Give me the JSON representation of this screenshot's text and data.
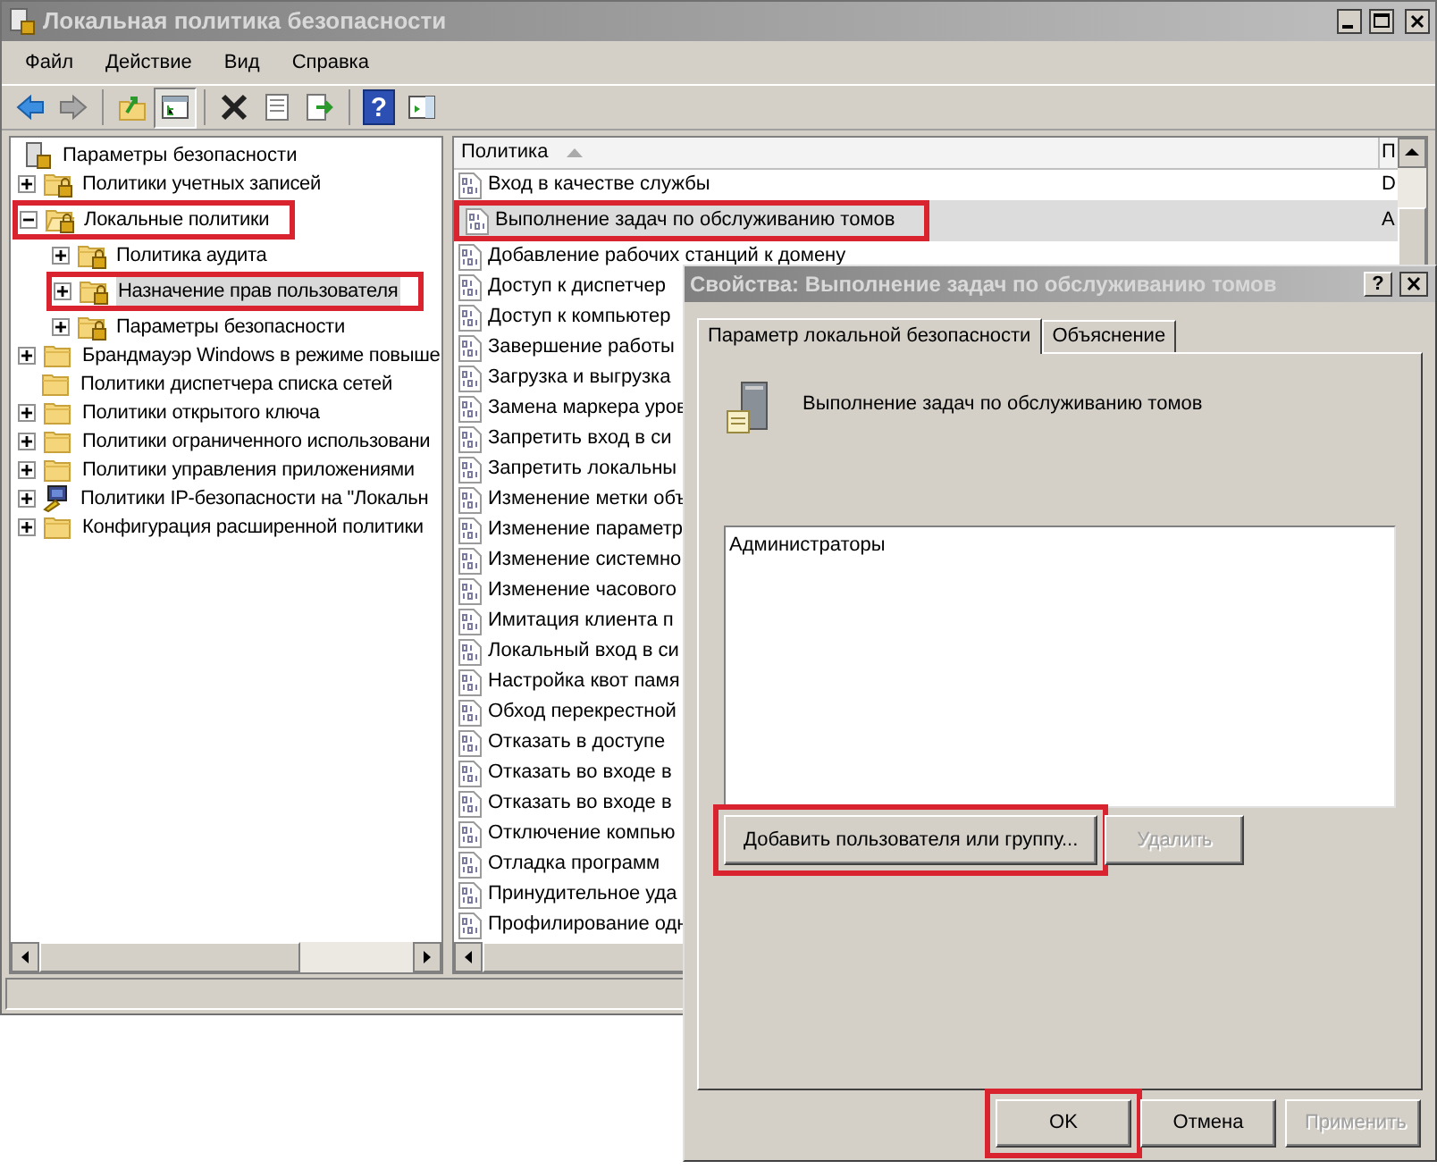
{
  "window": {
    "title": "Локальная политика безопасности"
  },
  "menu": [
    "Файл",
    "Действие",
    "Вид",
    "Справка"
  ],
  "toolbar": [
    [
      {
        "kind": "back",
        "pressed": false
      },
      {
        "kind": "forward",
        "pressed": false
      }
    ],
    [
      {
        "kind": "up",
        "pressed": false
      },
      {
        "kind": "tree",
        "pressed": true
      }
    ],
    [
      {
        "kind": "delete",
        "pressed": false
      },
      {
        "kind": "properties",
        "pressed": false
      },
      {
        "kind": "export",
        "pressed": false
      }
    ],
    [
      {
        "kind": "help",
        "pressed": false,
        "label": "?"
      },
      {
        "kind": "action-pane",
        "pressed": false
      }
    ]
  ],
  "tree": {
    "root": "Параметры безопасности",
    "items": [
      {
        "label": "Политики учетных записей",
        "kind": "secure-folder",
        "has_children": true,
        "expanded": false,
        "selected": false,
        "highlighted": false
      },
      {
        "label": "Локальные политики",
        "kind": "secure-folder",
        "has_children": true,
        "expanded": true,
        "selected": false,
        "highlighted": true,
        "children": [
          {
            "label": "Политика аудита",
            "kind": "secure-folder",
            "has_children": true,
            "expanded": false,
            "selected": false,
            "highlighted": false
          },
          {
            "label": "Назначение прав пользователя",
            "kind": "secure-folder",
            "has_children": true,
            "expanded": false,
            "selected": true,
            "highlighted": true
          },
          {
            "label": "Параметры безопасности",
            "kind": "secure-folder",
            "has_children": true,
            "expanded": false,
            "selected": false,
            "highlighted": false
          }
        ]
      },
      {
        "label": "Брандмауэр Windows в режиме повыше",
        "kind": "folder",
        "has_children": true,
        "expanded": false,
        "selected": false,
        "highlighted": false
      },
      {
        "label": "Политики диспетчера списка сетей",
        "kind": "folder",
        "has_children": false,
        "expanded": false,
        "selected": false,
        "highlighted": false
      },
      {
        "label": "Политики открытого ключа",
        "kind": "folder",
        "has_children": true,
        "expanded": false,
        "selected": false,
        "highlighted": false
      },
      {
        "label": "Политики ограниченного использовани",
        "kind": "folder",
        "has_children": true,
        "expanded": false,
        "selected": false,
        "highlighted": false
      },
      {
        "label": "Политики управления приложениями",
        "kind": "folder",
        "has_children": true,
        "expanded": false,
        "selected": false,
        "highlighted": false
      },
      {
        "label": "Политики IP-безопасности на \"Локальн",
        "kind": "ip-security",
        "has_children": true,
        "expanded": false,
        "selected": false,
        "highlighted": false
      },
      {
        "label": "Конфигурация расширенной политики",
        "kind": "folder",
        "has_children": true,
        "expanded": false,
        "selected": false,
        "highlighted": false
      }
    ]
  },
  "list": {
    "columns": [
      "Политика",
      "П"
    ],
    "rows": [
      {
        "cells": [
          "Вход в качестве службы",
          "D"
        ],
        "selected": false,
        "highlighted": false
      },
      {
        "cells": [
          "Выполнение задач по обслуживанию томов",
          "A"
        ],
        "selected": true,
        "highlighted": true
      },
      {
        "cells": [
          "Добавление рабочих станций к домену"
        ],
        "selected": false,
        "highlighted": false
      },
      {
        "cells": [
          "Доступ к диспетчер"
        ],
        "selected": false,
        "highlighted": false
      },
      {
        "cells": [
          "Доступ к компьютер"
        ],
        "selected": false,
        "highlighted": false
      },
      {
        "cells": [
          "Завершение работы"
        ],
        "selected": false,
        "highlighted": false
      },
      {
        "cells": [
          "Загрузка и выгрузка"
        ],
        "selected": false,
        "highlighted": false
      },
      {
        "cells": [
          "Замена маркера уров"
        ],
        "selected": false,
        "highlighted": false
      },
      {
        "cells": [
          "Запретить вход в си"
        ],
        "selected": false,
        "highlighted": false
      },
      {
        "cells": [
          "Запретить локальны"
        ],
        "selected": false,
        "highlighted": false
      },
      {
        "cells": [
          "Изменение метки объ"
        ],
        "selected": false,
        "highlighted": false
      },
      {
        "cells": [
          "Изменение параметр"
        ],
        "selected": false,
        "highlighted": false
      },
      {
        "cells": [
          "Изменение системно"
        ],
        "selected": false,
        "highlighted": false
      },
      {
        "cells": [
          "Изменение часового"
        ],
        "selected": false,
        "highlighted": false
      },
      {
        "cells": [
          "Имитация клиента п"
        ],
        "selected": false,
        "highlighted": false
      },
      {
        "cells": [
          "Локальный вход в си"
        ],
        "selected": false,
        "highlighted": false
      },
      {
        "cells": [
          "Настройка квот памя"
        ],
        "selected": false,
        "highlighted": false
      },
      {
        "cells": [
          "Обход перекрестной"
        ],
        "selected": false,
        "highlighted": false
      },
      {
        "cells": [
          "Отказать в доступе"
        ],
        "selected": false,
        "highlighted": false
      },
      {
        "cells": [
          "Отказать во входе в"
        ],
        "selected": false,
        "highlighted": false
      },
      {
        "cells": [
          "Отказать во входе в"
        ],
        "selected": false,
        "highlighted": false
      },
      {
        "cells": [
          "Отключение компью"
        ],
        "selected": false,
        "highlighted": false
      },
      {
        "cells": [
          "Отладка программ"
        ],
        "selected": false,
        "highlighted": false
      },
      {
        "cells": [
          "Принудительное уда"
        ],
        "selected": false,
        "highlighted": false
      },
      {
        "cells": [
          "Профилирование одн"
        ],
        "selected": false,
        "highlighted": false
      }
    ]
  },
  "dialog": {
    "title": "Свойства: Выполнение задач по обслуживанию томов",
    "help_label": "?",
    "tabs": [
      {
        "label": "Параметр локальной безопасности",
        "selected": true
      },
      {
        "label": "Объяснение",
        "selected": false
      }
    ],
    "policy_name": "Выполнение задач по обслуживанию томов",
    "members": [
      "Администраторы"
    ],
    "member_buttons": [
      {
        "label": "Добавить пользователя или группу...",
        "disabled": false,
        "highlighted": true
      },
      {
        "label": "Удалить",
        "disabled": true,
        "highlighted": false
      }
    ],
    "buttons": [
      {
        "label": "OK",
        "disabled": false,
        "highlighted": true
      },
      {
        "label": "Отмена",
        "disabled": false,
        "highlighted": false
      },
      {
        "label": "Применить",
        "disabled": true,
        "highlighted": false
      }
    ]
  }
}
